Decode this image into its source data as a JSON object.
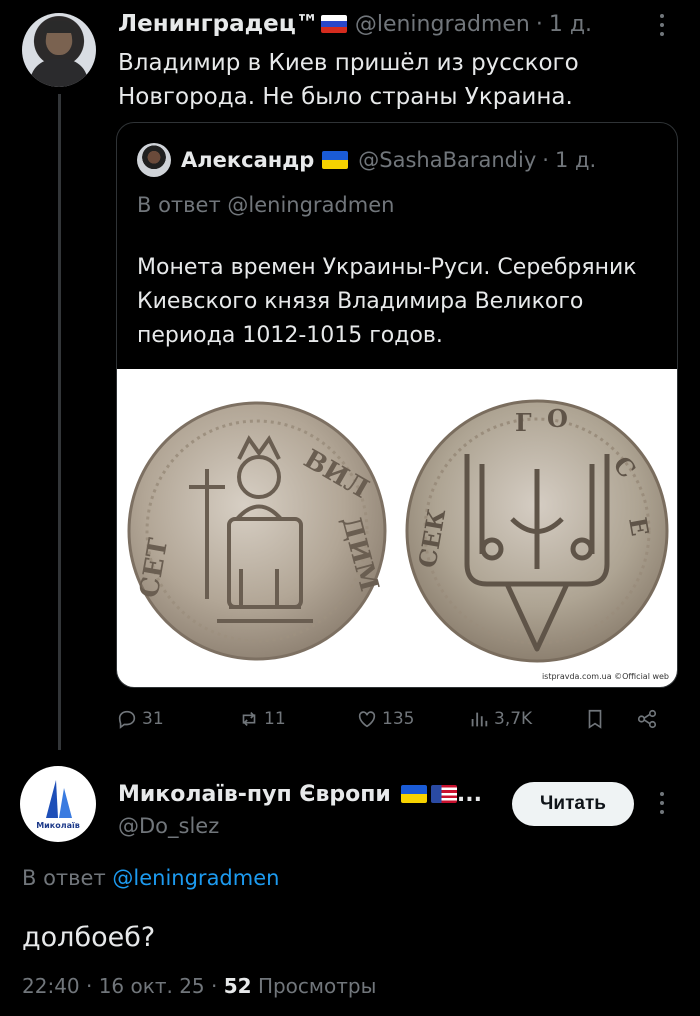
{
  "tweet": {
    "author_name": "Ленинградец™",
    "handle": "@leningradmen",
    "separator": "·",
    "time": "1 д.",
    "text": "Владимир в Киев пришёл из русского Новгорода. Не было страны Украина."
  },
  "quoted": {
    "author_name": "Александр",
    "handle": "@SashaBarandiy",
    "separator": "·",
    "time": "1 д.",
    "reply_prefix": "В ответ",
    "reply_to": "@leningradmen",
    "text": "Монета времен Украины-Руси. Серебряник Киевского князя Владимира Великого периода 1012-1015 годов.",
    "image_watermark": "istpravda.com.ua ©Official web"
  },
  "actions": {
    "replies": "31",
    "reposts": "11",
    "likes": "135",
    "views": "3,7K"
  },
  "reply": {
    "author_name": "Миколаїв-пуп Європи",
    "name_ellipsis": "...",
    "handle": "@Do_slez",
    "follow_label": "Читать",
    "reply_prefix": "В ответ",
    "reply_to": "@leningradmen",
    "text": "долбоеб?",
    "timestamp": "22:40 · 16 окт. 25 ·",
    "views_count": "52",
    "views_label": "Просмотры",
    "avatar_label": "Миколаїв"
  },
  "colors": {
    "background": "#000000",
    "text": "#e7e9ea",
    "muted": "#71767b",
    "link": "#1d9bf0",
    "border": "#2f3336"
  }
}
